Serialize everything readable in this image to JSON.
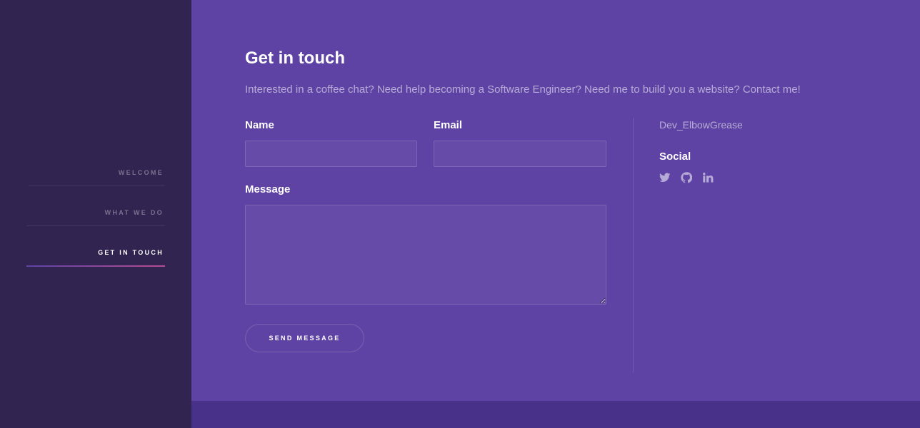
{
  "nav": {
    "items": [
      {
        "label": "WELCOME",
        "active": false
      },
      {
        "label": "WHAT WE DO",
        "active": false
      },
      {
        "label": "GET IN TOUCH",
        "active": true
      }
    ]
  },
  "contact": {
    "title": "Get in touch",
    "intro": "Interested in a coffee chat? Need help becoming a Software Engineer? Need me to build you a website? Contact me!",
    "form": {
      "name_label": "Name",
      "name_value": "",
      "email_label": "Email",
      "email_value": "",
      "message_label": "Message",
      "message_value": "",
      "send_label": "SEND MESSAGE"
    },
    "info": {
      "handle": "Dev_ElbowGrease",
      "social_title": "Social",
      "icons": [
        "twitter-icon",
        "github-icon",
        "linkedin-icon"
      ]
    }
  },
  "colors": {
    "sidebar_bg": "#312450",
    "main_bg": "#5e43a4",
    "footer_bg": "#473189",
    "accent_gradient_start": "#5e42a6",
    "accent_gradient_end": "#b74e91"
  }
}
